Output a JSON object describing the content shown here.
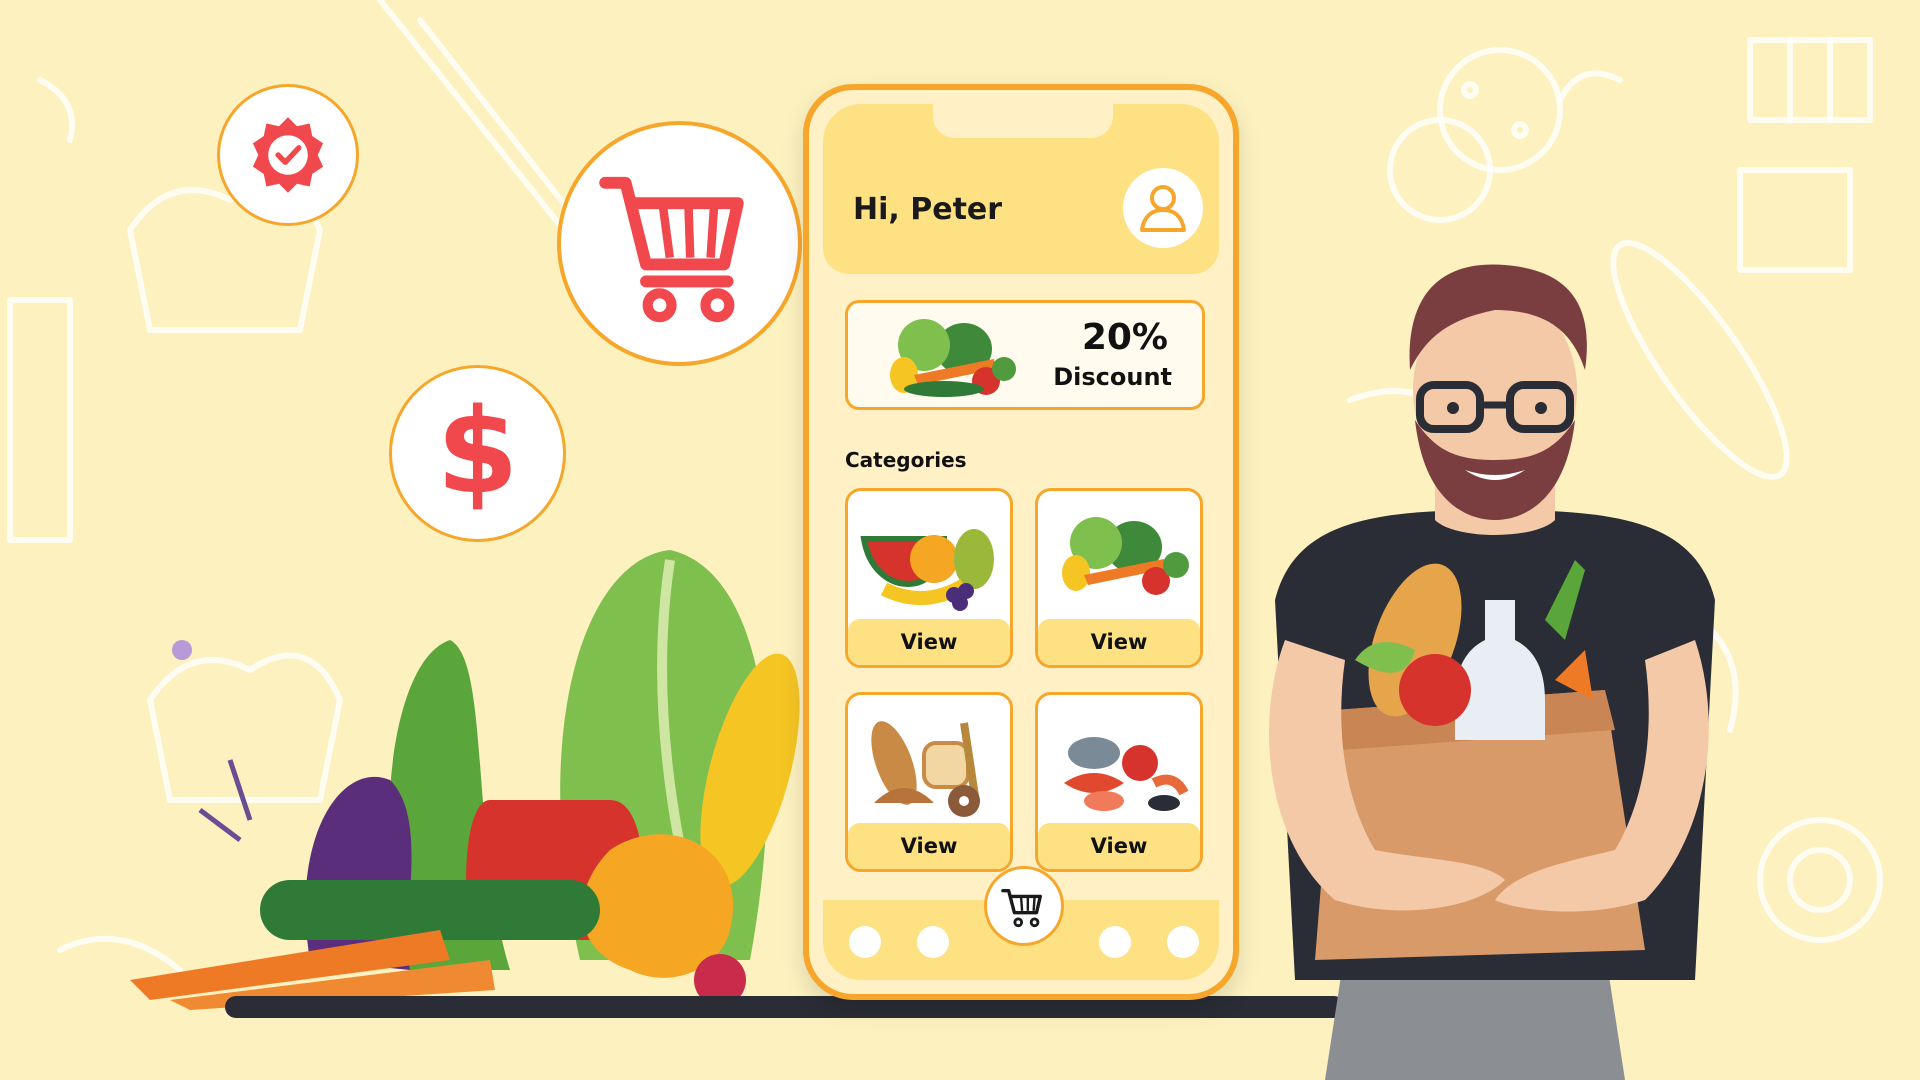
{
  "app": {
    "greeting": "Hi, Peter"
  },
  "promo": {
    "percent": "20%",
    "label": "Discount"
  },
  "categories": {
    "title": "Categories",
    "items": [
      {
        "icon": "fruits-image",
        "button": "View"
      },
      {
        "icon": "vegetables-image",
        "button": "View"
      },
      {
        "icon": "bakery-image",
        "button": "View"
      },
      {
        "icon": "seafood-image",
        "button": "View"
      }
    ]
  },
  "badges": {
    "verified_icon": "verified-badge-icon",
    "cart_icon": "shopping-cart-icon",
    "dollar_glyph": "$"
  },
  "colors": {
    "background": "#fcf1bf",
    "accent": "#f7a62c",
    "header": "#fde183",
    "icon_red": "#f0484d"
  }
}
